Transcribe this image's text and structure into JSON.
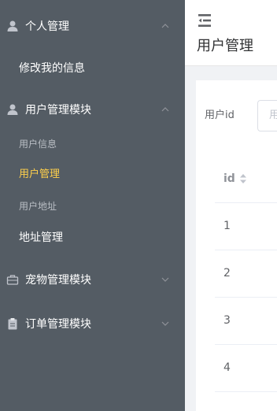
{
  "sidebar": {
    "groups": [
      {
        "label": "个人管理",
        "icon": "user-icon"
      },
      {
        "label": "用户管理模块",
        "icon": "user-icon"
      },
      {
        "label": "宠物管理模块",
        "icon": "briefcase-icon"
      },
      {
        "label": "订单管理模块",
        "icon": "clipboard-icon"
      }
    ],
    "items": {
      "edit_my_info": "修改我的信息",
      "user_info": "用户信息",
      "user_manage": "用户管理",
      "user_address": "用户地址",
      "address_manage": "地址管理"
    },
    "colors": {
      "background": "#545c64",
      "active_text": "#ffd04b"
    }
  },
  "header": {
    "collapse_icon": "menu-fold-icon",
    "title": "用户管理"
  },
  "filter": {
    "label": "用户id",
    "placeholder_visible": "用"
  },
  "table": {
    "columns": [
      {
        "label": "id",
        "sortable": true
      }
    ],
    "rows": [
      [
        "1"
      ],
      [
        "2"
      ],
      [
        "3"
      ],
      [
        "4"
      ]
    ]
  }
}
